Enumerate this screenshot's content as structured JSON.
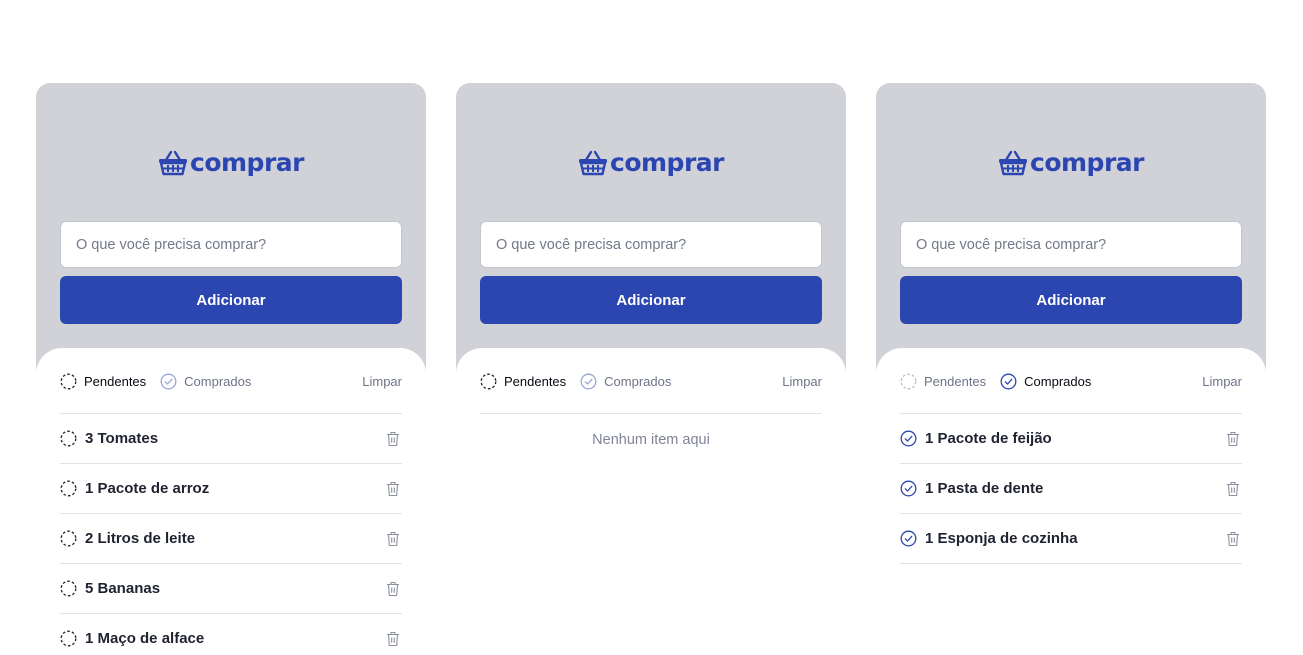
{
  "brand": {
    "name": "comprar",
    "color": "#2c46b1"
  },
  "screens": [
    {
      "input_placeholder": "O que você precisa comprar?",
      "add_label": "Adicionar",
      "filters": {
        "pending": "Pendentes",
        "bought": "Comprados",
        "active": "pending"
      },
      "clear_label": "Limpar",
      "items": [
        {
          "label": "3 Tomates",
          "status": "pending"
        },
        {
          "label": "1 Pacote de arroz",
          "status": "pending"
        },
        {
          "label": "2 Litros de leite",
          "status": "pending"
        },
        {
          "label": "5 Bananas",
          "status": "pending"
        },
        {
          "label": "1 Maço de alface",
          "status": "pending"
        }
      ]
    },
    {
      "input_placeholder": "O que você precisa comprar?",
      "add_label": "Adicionar",
      "filters": {
        "pending": "Pendentes",
        "bought": "Comprados",
        "active": "pending"
      },
      "clear_label": "Limpar",
      "empty_text": "Nenhum item aqui",
      "items": []
    },
    {
      "input_placeholder": "O que você precisa comprar?",
      "add_label": "Adicionar",
      "filters": {
        "pending": "Pendentes",
        "bought": "Comprados",
        "active": "bought"
      },
      "clear_label": "Limpar",
      "items": [
        {
          "label": "1 Pacote de feijão",
          "status": "bought"
        },
        {
          "label": "1 Pasta de dente",
          "status": "bought"
        },
        {
          "label": "1 Esponja de cozinha",
          "status": "bought"
        }
      ]
    }
  ],
  "icons": {
    "logo": "basket-icon",
    "pending": "dashed-circle-icon",
    "bought": "check-circle-icon",
    "delete": "trash-icon"
  },
  "colors": {
    "primary": "#2c46b1",
    "header_bg": "#d1d2d8",
    "text_dark": "#1f2230",
    "text_muted": "#6e7387"
  }
}
